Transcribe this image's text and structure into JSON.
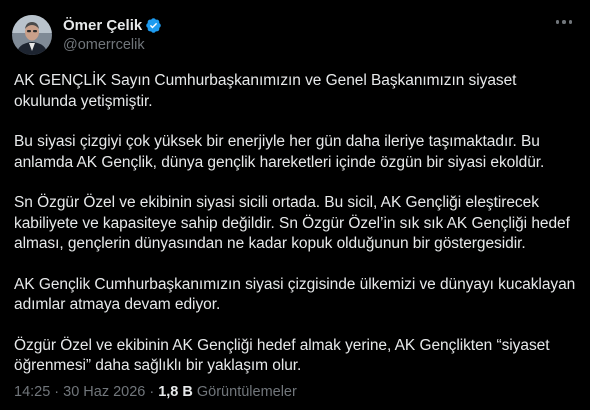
{
  "author": {
    "display_name": "Ömer Çelik",
    "handle": "@omerrcelik",
    "verified": true,
    "verified_color": "#1d9bf0"
  },
  "tweet": {
    "paragraphs": [
      "AK GENÇLİK Sayın Cumhurbaşkanımızın ve Genel Başkanımızın siyaset okulunda yetişmiştir.",
      "Bu siyasi çizgiyi çok yüksek bir enerjiyle her gün daha ileriye taşımaktadır. Bu anlamda AK Gençlik, dünya gençlik hareketleri içinde özgün bir siyasi ekoldür.",
      "Sn Özgür Özel ve ekibinin siyasi sicili ortada. Bu sicil, AK Gençliği eleştirecek kabiliyete ve kapasiteye sahip değildir. Sn Özgür Özel’in sık sık AK Gençliği hedef alması, gençlerin dünyasından ne kadar kopuk olduğunun bir göstergesidir.",
      "AK Gençlik Cumhurbaşkanımızın siyasi çizgisinde ülkemizi ve dünyayı kucaklayan adımlar atmaya devam ediyor.",
      "Özgür Özel ve ekibinin AK Gençliği hedef almak yerine, AK Gençlikten “siyaset öğrenmesi” daha sağlıklı bir yaklaşım olur."
    ]
  },
  "meta": {
    "time": "14:25",
    "separator": "·",
    "date": "30 Haz 2026",
    "views_count": "1,8 B",
    "views_label": "Görüntülemeler"
  },
  "icons": {
    "more": "more-options-icon",
    "verified": "verified-badge-icon"
  }
}
